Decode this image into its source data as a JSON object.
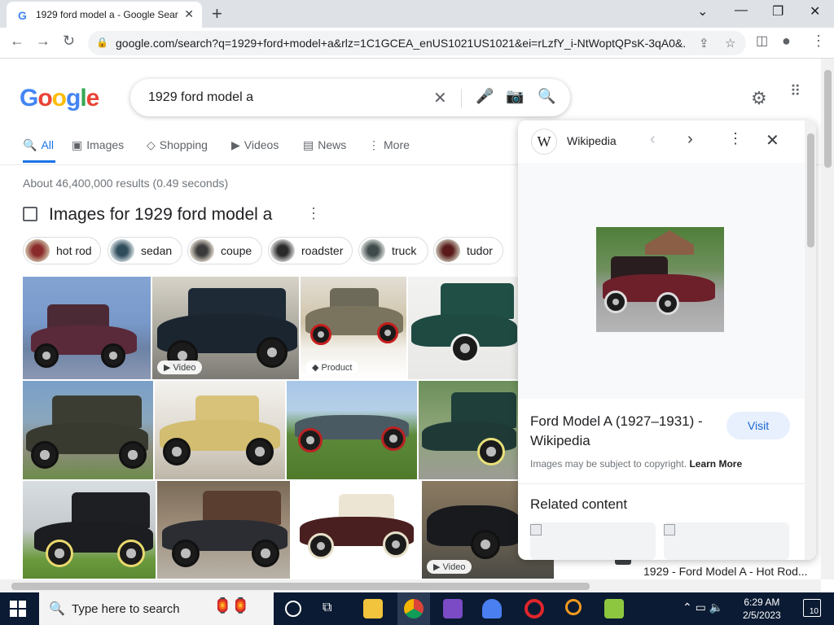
{
  "browser": {
    "tab_title": "1929 ford model a - Google Sear",
    "favicon": "G",
    "new_tab": "+",
    "url": "google.com/search?q=1929+ford+model+a&rlz=1C1GCEA_enUS1021US1021&ei=rLzfY_i-NtWoptQPsK-3qA0&...",
    "win_minimize": "—",
    "win_restore": "❐",
    "win_close": "✕",
    "win_dropdown": "⌄"
  },
  "google": {
    "logo": [
      "G",
      "o",
      "o",
      "g",
      "l",
      "e"
    ],
    "logo_colors": [
      "#4285f4",
      "#ea4335",
      "#fbbc05",
      "#4285f4",
      "#34a853",
      "#ea4335"
    ],
    "query": "1929 ford model a",
    "tabs": [
      {
        "label": "All",
        "icon": "🔍"
      },
      {
        "label": "Images",
        "icon": "▣"
      },
      {
        "label": "Shopping",
        "icon": "◇"
      },
      {
        "label": "Videos",
        "icon": "▶"
      },
      {
        "label": "News",
        "icon": "▤"
      },
      {
        "label": "More",
        "icon": "⋮"
      }
    ],
    "stats": "About 46,400,000 results (0.49 seconds)",
    "images_heading": "Images for 1929 ford model a",
    "chips": [
      "hot rod",
      "sedan",
      "coupe",
      "roadster",
      "truck",
      "tudor"
    ],
    "badges": {
      "video": "Video",
      "product": "Product"
    }
  },
  "panel": {
    "source": "Wikipedia",
    "source_logo": "W",
    "title": "Ford Model A (1927–1931) - Wikipedia",
    "visit": "Visit",
    "copyright": "Images may be subject to copyright.",
    "learn_more": "Learn More",
    "related": "Related content"
  },
  "behind_result": "1929 - Ford Model A - Hot Rod...",
  "taskbar": {
    "search_placeholder": "Type here to search",
    "time": "6:29 AM",
    "date": "2/5/2023",
    "notifications": "10"
  },
  "colors": {
    "accent": "#1a73e8",
    "visit_bg": "#e8f0fe",
    "taskbar": "#0b1b33"
  }
}
